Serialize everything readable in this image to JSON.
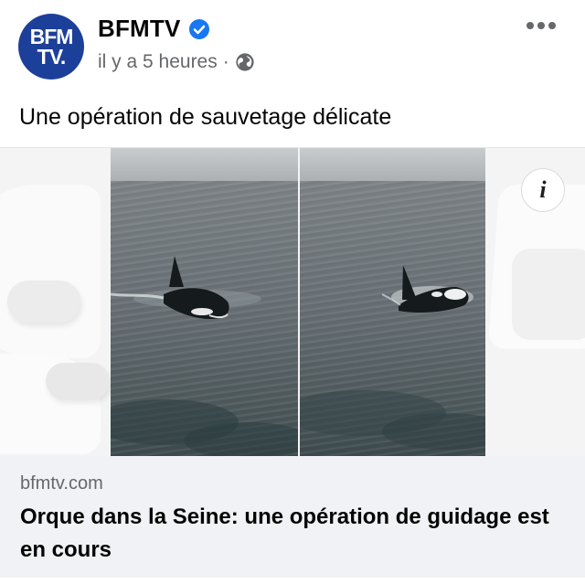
{
  "post": {
    "page_name": "BFMTV",
    "avatar_text_line1": "BFM",
    "avatar_text_line2": "TV.",
    "timestamp": "il y a 5 heures",
    "separator": "·",
    "text": "Une opération de sauvetage délicate"
  },
  "icons": {
    "verified": "verified-badge-icon",
    "audience": "globe-icon",
    "more": "more-options-icon",
    "info": "info-icon"
  },
  "link_preview": {
    "domain": "bfmtv.com",
    "title": "Orque dans la Seine: une opération de guidage est en cours"
  },
  "colors": {
    "brand_blue": "#1c3f99",
    "verified_blue": "#1877f2",
    "secondary_text": "#65676b",
    "preview_bg": "#f0f2f5"
  }
}
